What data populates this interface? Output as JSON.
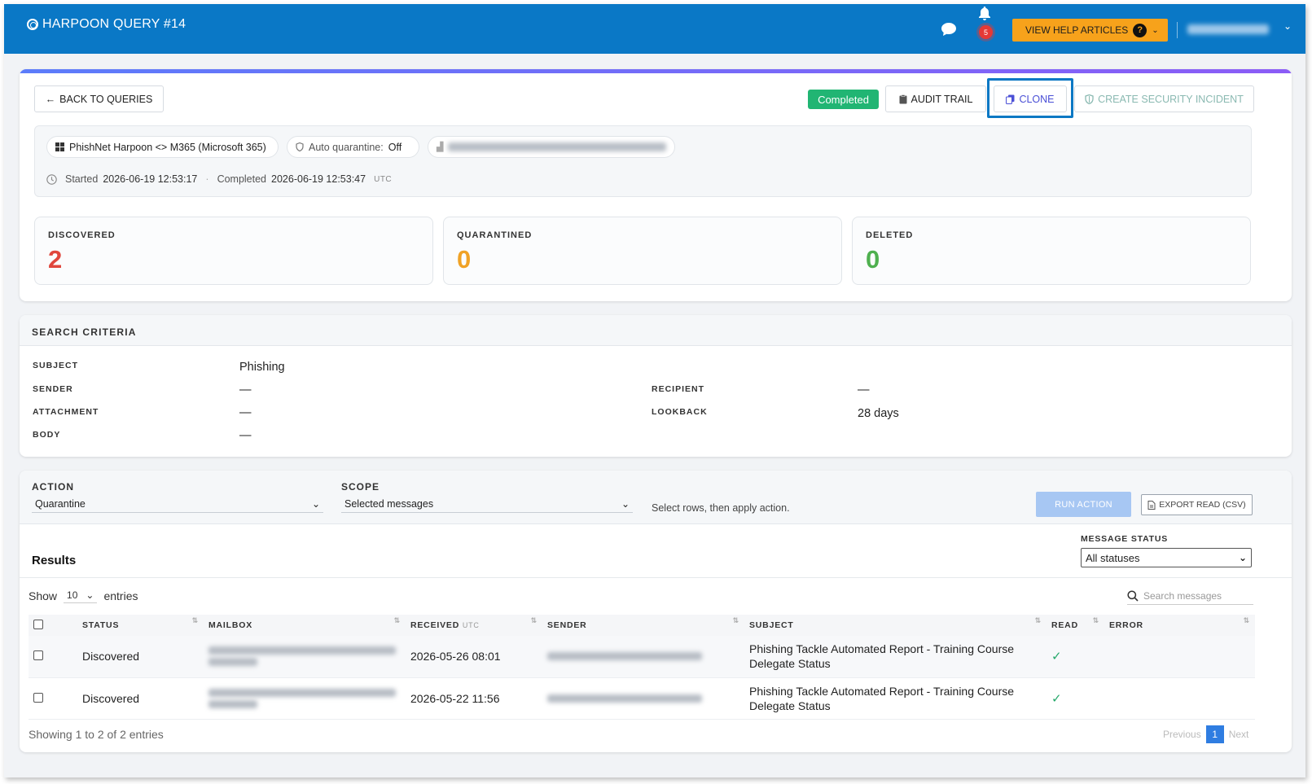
{
  "header": {
    "title": "HARPOON QUERY #14",
    "notification_count": "5",
    "help_label": "VIEW HELP ARTICLES",
    "help_icon": "?"
  },
  "toolbar": {
    "back_label": "BACK TO QUERIES",
    "status_badge": "Completed",
    "audit_label": "AUDIT TRAIL",
    "clone_label": "CLONE",
    "incident_label": "CREATE SECURITY INCIDENT"
  },
  "meta": {
    "source": "PhishNet Harpoon <> M365 (Microsoft 365)",
    "auto_quarantine_label": "Auto quarantine:",
    "auto_quarantine_value": "Off",
    "started_label": "Started",
    "started_value": "2026-06-19 12:53:17",
    "separator": "·",
    "completed_label": "Completed",
    "completed_value": "2026-06-19 12:53:47",
    "timezone": "UTC"
  },
  "stats": [
    {
      "label": "DISCOVERED",
      "value": "2",
      "color": "#e0473d"
    },
    {
      "label": "QUARANTINED",
      "value": "0",
      "color": "#f0a226"
    },
    {
      "label": "DELETED",
      "value": "0",
      "color": "#4fb04f"
    }
  ],
  "criteria": {
    "title": "SEARCH CRITERIA",
    "subject_label": "SUBJECT",
    "subject_value": "Phishing",
    "sender_label": "SENDER",
    "sender_value": "—",
    "attachment_label": "ATTACHMENT",
    "attachment_value": "—",
    "body_label": "BODY",
    "body_value": "—",
    "recipient_label": "RECIPIENT",
    "recipient_value": "—",
    "lookback_label": "LOOKBACK",
    "lookback_value": "28 days"
  },
  "actions": {
    "action_label": "ACTION",
    "action_value": "Quarantine",
    "scope_label": "SCOPE",
    "scope_value": "Selected messages",
    "hint": "Select rows, then apply action.",
    "run_label": "RUN ACTION",
    "export_label": "EXPORT READ (CSV)"
  },
  "results": {
    "title": "Results",
    "status_filter_label": "MESSAGE STATUS",
    "status_filter_value": "All statuses",
    "show_label": "Show",
    "entries_value": "10",
    "entries_label": "entries",
    "search_placeholder": "Search messages",
    "columns": {
      "status": "STATUS",
      "mailbox": "MAILBOX",
      "received": "RECEIVED",
      "received_tz": "UTC",
      "sender": "SENDER",
      "subject": "SUBJECT",
      "read": "READ",
      "error": "ERROR"
    },
    "rows": [
      {
        "status": "Discovered",
        "received": "2026-05-26 08:01",
        "subject": "Phishing Tackle Automated Report - Training Course Delegate Status",
        "read": "✓"
      },
      {
        "status": "Discovered",
        "received": "2026-05-22 11:56",
        "subject": "Phishing Tackle Automated Report - Training Course Delegate Status",
        "read": "✓"
      }
    ],
    "showing": "Showing 1 to 2 of 2 entries",
    "prev_label": "Previous",
    "page": "1",
    "next_label": "Next"
  }
}
